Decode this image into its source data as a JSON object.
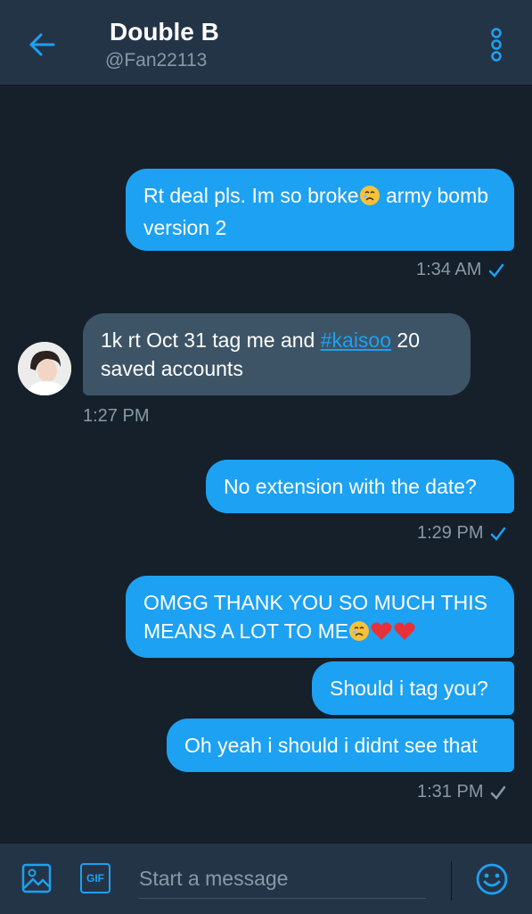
{
  "header": {
    "title": "Double B",
    "handle": "@Fan22113"
  },
  "messages": [
    {
      "direction": "out",
      "text": "Rt deal pls. Im so broke",
      "text_after_emoji": " army bomb version 2"
    },
    {
      "direction": "out",
      "timestamp": "1:34 AM",
      "status": "sent"
    },
    {
      "direction": "in",
      "text_before": "1k rt Oct 31 tag me and ",
      "hashtag": "#kaisoo",
      "text_after": " 20 saved accounts",
      "timestamp": "1:27 PM"
    },
    {
      "direction": "out",
      "text": "No extension with the date?",
      "timestamp": "1:29 PM",
      "status": "sent"
    },
    {
      "direction": "out",
      "text": "OMGG THANK YOU SO MUCH THIS MEANS A LOT TO ME"
    },
    {
      "direction": "out",
      "text": "Should i tag you?"
    },
    {
      "direction": "out",
      "text": "Oh yeah i should i didnt see that",
      "timestamp": "1:31 PM",
      "status": "read"
    }
  ],
  "composer": {
    "placeholder": "Start a message",
    "gif_label": "GIF"
  },
  "colors": {
    "background": "#15202b",
    "header": "#243447",
    "accent": "#1da1f2",
    "incoming_bubble": "#3d5466",
    "muted_text": "#8899a6"
  },
  "icons": [
    "back-arrow-icon",
    "more-options-icon",
    "image-icon",
    "gif-icon",
    "emoji-icon",
    "check-icon"
  ]
}
